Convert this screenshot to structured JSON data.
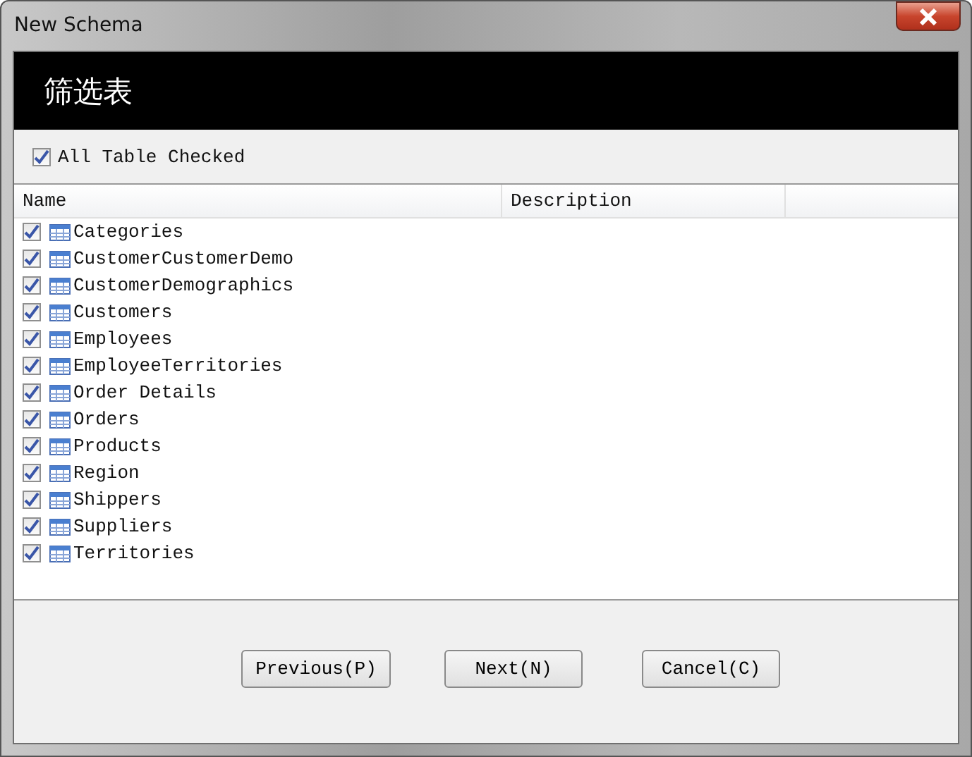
{
  "window": {
    "title": "New Schema"
  },
  "header": {
    "title": "筛选表"
  },
  "all_checked": {
    "label": "All Table Checked",
    "checked": true
  },
  "table": {
    "columns": [
      "Name",
      "Description"
    ],
    "rows": [
      {
        "name": "Categories",
        "checked": true
      },
      {
        "name": "CustomerCustomerDemo",
        "checked": true
      },
      {
        "name": "CustomerDemographics",
        "checked": true
      },
      {
        "name": "Customers",
        "checked": true
      },
      {
        "name": "Employees",
        "checked": true
      },
      {
        "name": "EmployeeTerritories",
        "checked": true
      },
      {
        "name": "Order Details",
        "checked": true
      },
      {
        "name": "Orders",
        "checked": true
      },
      {
        "name": "Products",
        "checked": true
      },
      {
        "name": "Region",
        "checked": true
      },
      {
        "name": "Shippers",
        "checked": true
      },
      {
        "name": "Suppliers",
        "checked": true
      },
      {
        "name": "Territories",
        "checked": true
      }
    ]
  },
  "buttons": [
    "Previous(P)",
    "Next(N)",
    "Cancel(C)"
  ]
}
